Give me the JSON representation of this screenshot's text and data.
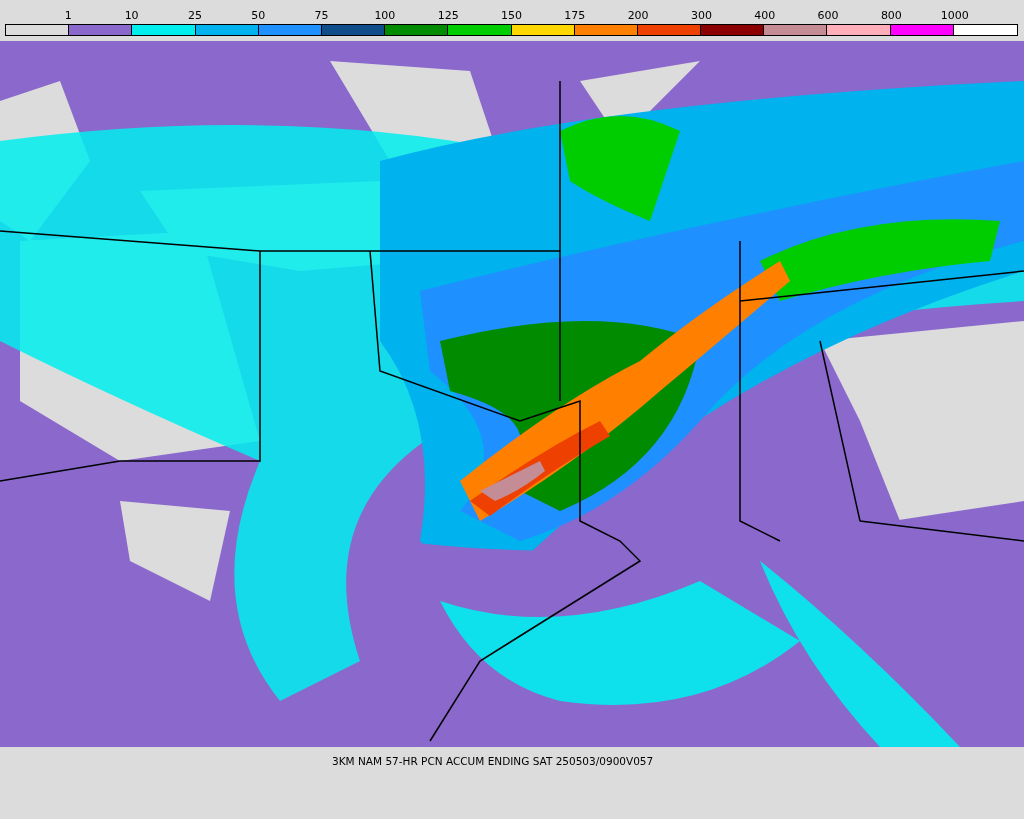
{
  "legend": [
    {
      "color": "#dcdcdc",
      "label": "1"
    },
    {
      "color": "#8b68cc",
      "label": "10"
    },
    {
      "color": "#00eeee",
      "label": "25"
    },
    {
      "color": "#00b2ee",
      "label": "50"
    },
    {
      "color": "#1e90ff",
      "label": "75"
    },
    {
      "color": "#104e8b",
      "label": "100"
    },
    {
      "color": "#008b00",
      "label": "125"
    },
    {
      "color": "#00cd00",
      "label": "150"
    },
    {
      "color": "#ffd700",
      "label": "175"
    },
    {
      "color": "#ff8000",
      "label": "200"
    },
    {
      "color": "#ee4000",
      "label": "300"
    },
    {
      "color": "#8b0000",
      "label": "400"
    },
    {
      "color": "#c48c94",
      "label": "600"
    },
    {
      "color": "#ffaeb9",
      "label": "800"
    },
    {
      "color": "#ff00ff",
      "label": "1000"
    },
    {
      "color": "#ffffff"
    }
  ],
  "caption": "3KM NAM 57-HR PCN ACCUM ENDING SAT 250503/0900V057"
}
